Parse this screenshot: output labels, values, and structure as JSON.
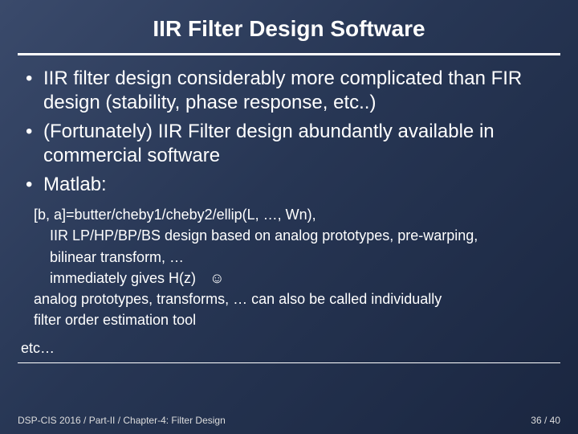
{
  "title": "IIR Filter Design Software",
  "bullets": [
    "IIR filter design considerably more complicated than FIR design (stability, phase response, etc..)",
    "(Fortunately) IIR Filter design abundantly available in commercial software",
    "Matlab:"
  ],
  "sub": {
    "l1": "[b, a]=butter/cheby1/cheby2/ellip(L, …, Wn),",
    "l2": "IIR  LP/HP/BP/BS design based on analog prototypes, pre-warping,",
    "l3": "bilinear transform, …",
    "l4a": "immediately gives H(z)",
    "l4b": "☺",
    "l5": "analog prototypes, transforms, … can also be called individually",
    "l6": "filter order estimation tool",
    "l7": "etc…"
  },
  "footer": {
    "left": "DSP-CIS 2016  /  Part-II  /  Chapter-4: Filter Design",
    "right": "36 / 40"
  }
}
